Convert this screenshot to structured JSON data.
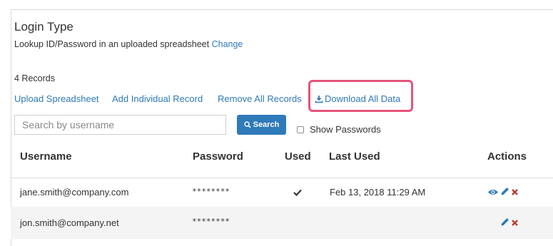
{
  "login": {
    "title": "Login Type",
    "description": "Lookup ID/Password in an uploaded spreadsheet",
    "change_link": "Change"
  },
  "records_count": "4 Records",
  "toolbar": {
    "upload_label": "Upload Spreadsheet",
    "add_label": "Add Individual Record",
    "remove_label": "Remove All Records",
    "download_label": "Download All Data"
  },
  "search": {
    "placeholder": "Search by username",
    "button_label": "Search",
    "show_passwords_label": "Show Passwords",
    "show_passwords_checked": false
  },
  "table": {
    "headers": {
      "username": "Username",
      "password": "Password",
      "used": "Used",
      "last_used": "Last Used",
      "actions": "Actions"
    },
    "rows": [
      {
        "username": "jane.smith@company.com",
        "password": "********",
        "used": true,
        "last_used": "Feb 13, 2018 11:29 AM",
        "actions": [
          "view-icon",
          "edit-icon",
          "delete-icon"
        ]
      },
      {
        "username": "jon.smith@company.net",
        "password": "********",
        "used": false,
        "last_used": "",
        "actions": [
          "edit-icon",
          "delete-icon"
        ]
      }
    ]
  },
  "colors": {
    "link": "#2f7ab8",
    "highlight": "#e6537a",
    "delete": "#c0392b",
    "button": "#2f7ab8"
  }
}
